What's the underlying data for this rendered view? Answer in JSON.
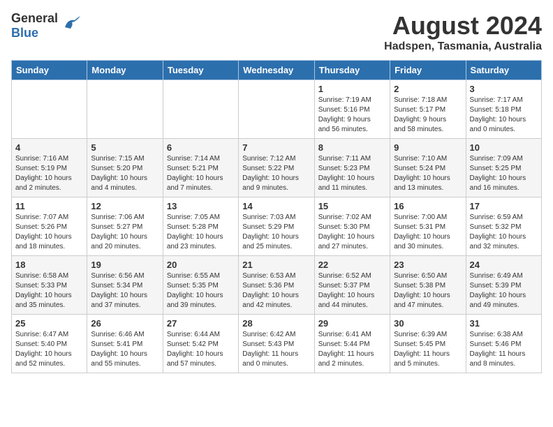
{
  "header": {
    "logo_general": "General",
    "logo_blue": "Blue",
    "month_year": "August 2024",
    "location": "Hadspen, Tasmania, Australia"
  },
  "days_of_week": [
    "Sunday",
    "Monday",
    "Tuesday",
    "Wednesday",
    "Thursday",
    "Friday",
    "Saturday"
  ],
  "weeks": [
    [
      {
        "day": "",
        "info": ""
      },
      {
        "day": "",
        "info": ""
      },
      {
        "day": "",
        "info": ""
      },
      {
        "day": "",
        "info": ""
      },
      {
        "day": "1",
        "info": "Sunrise: 7:19 AM\nSunset: 5:16 PM\nDaylight: 9 hours\nand 56 minutes."
      },
      {
        "day": "2",
        "info": "Sunrise: 7:18 AM\nSunset: 5:17 PM\nDaylight: 9 hours\nand 58 minutes."
      },
      {
        "day": "3",
        "info": "Sunrise: 7:17 AM\nSunset: 5:18 PM\nDaylight: 10 hours\nand 0 minutes."
      }
    ],
    [
      {
        "day": "4",
        "info": "Sunrise: 7:16 AM\nSunset: 5:19 PM\nDaylight: 10 hours\nand 2 minutes."
      },
      {
        "day": "5",
        "info": "Sunrise: 7:15 AM\nSunset: 5:20 PM\nDaylight: 10 hours\nand 4 minutes."
      },
      {
        "day": "6",
        "info": "Sunrise: 7:14 AM\nSunset: 5:21 PM\nDaylight: 10 hours\nand 7 minutes."
      },
      {
        "day": "7",
        "info": "Sunrise: 7:12 AM\nSunset: 5:22 PM\nDaylight: 10 hours\nand 9 minutes."
      },
      {
        "day": "8",
        "info": "Sunrise: 7:11 AM\nSunset: 5:23 PM\nDaylight: 10 hours\nand 11 minutes."
      },
      {
        "day": "9",
        "info": "Sunrise: 7:10 AM\nSunset: 5:24 PM\nDaylight: 10 hours\nand 13 minutes."
      },
      {
        "day": "10",
        "info": "Sunrise: 7:09 AM\nSunset: 5:25 PM\nDaylight: 10 hours\nand 16 minutes."
      }
    ],
    [
      {
        "day": "11",
        "info": "Sunrise: 7:07 AM\nSunset: 5:26 PM\nDaylight: 10 hours\nand 18 minutes."
      },
      {
        "day": "12",
        "info": "Sunrise: 7:06 AM\nSunset: 5:27 PM\nDaylight: 10 hours\nand 20 minutes."
      },
      {
        "day": "13",
        "info": "Sunrise: 7:05 AM\nSunset: 5:28 PM\nDaylight: 10 hours\nand 23 minutes."
      },
      {
        "day": "14",
        "info": "Sunrise: 7:03 AM\nSunset: 5:29 PM\nDaylight: 10 hours\nand 25 minutes."
      },
      {
        "day": "15",
        "info": "Sunrise: 7:02 AM\nSunset: 5:30 PM\nDaylight: 10 hours\nand 27 minutes."
      },
      {
        "day": "16",
        "info": "Sunrise: 7:00 AM\nSunset: 5:31 PM\nDaylight: 10 hours\nand 30 minutes."
      },
      {
        "day": "17",
        "info": "Sunrise: 6:59 AM\nSunset: 5:32 PM\nDaylight: 10 hours\nand 32 minutes."
      }
    ],
    [
      {
        "day": "18",
        "info": "Sunrise: 6:58 AM\nSunset: 5:33 PM\nDaylight: 10 hours\nand 35 minutes."
      },
      {
        "day": "19",
        "info": "Sunrise: 6:56 AM\nSunset: 5:34 PM\nDaylight: 10 hours\nand 37 minutes."
      },
      {
        "day": "20",
        "info": "Sunrise: 6:55 AM\nSunset: 5:35 PM\nDaylight: 10 hours\nand 39 minutes."
      },
      {
        "day": "21",
        "info": "Sunrise: 6:53 AM\nSunset: 5:36 PM\nDaylight: 10 hours\nand 42 minutes."
      },
      {
        "day": "22",
        "info": "Sunrise: 6:52 AM\nSunset: 5:37 PM\nDaylight: 10 hours\nand 44 minutes."
      },
      {
        "day": "23",
        "info": "Sunrise: 6:50 AM\nSunset: 5:38 PM\nDaylight: 10 hours\nand 47 minutes."
      },
      {
        "day": "24",
        "info": "Sunrise: 6:49 AM\nSunset: 5:39 PM\nDaylight: 10 hours\nand 49 minutes."
      }
    ],
    [
      {
        "day": "25",
        "info": "Sunrise: 6:47 AM\nSunset: 5:40 PM\nDaylight: 10 hours\nand 52 minutes."
      },
      {
        "day": "26",
        "info": "Sunrise: 6:46 AM\nSunset: 5:41 PM\nDaylight: 10 hours\nand 55 minutes."
      },
      {
        "day": "27",
        "info": "Sunrise: 6:44 AM\nSunset: 5:42 PM\nDaylight: 10 hours\nand 57 minutes."
      },
      {
        "day": "28",
        "info": "Sunrise: 6:42 AM\nSunset: 5:43 PM\nDaylight: 11 hours\nand 0 minutes."
      },
      {
        "day": "29",
        "info": "Sunrise: 6:41 AM\nSunset: 5:44 PM\nDaylight: 11 hours\nand 2 minutes."
      },
      {
        "day": "30",
        "info": "Sunrise: 6:39 AM\nSunset: 5:45 PM\nDaylight: 11 hours\nand 5 minutes."
      },
      {
        "day": "31",
        "info": "Sunrise: 6:38 AM\nSunset: 5:46 PM\nDaylight: 11 hours\nand 8 minutes."
      }
    ]
  ]
}
